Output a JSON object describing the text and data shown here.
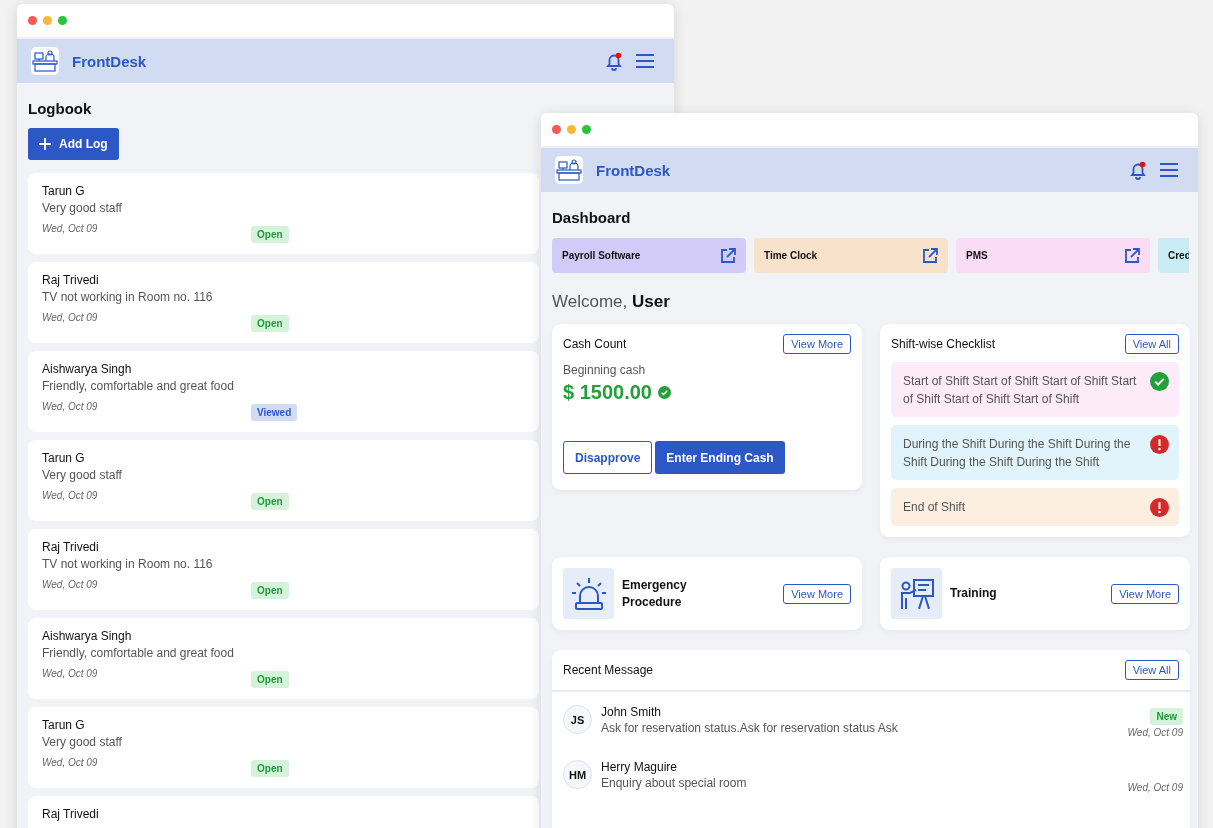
{
  "logbook_window": {
    "app_name": "FrontDesk",
    "notification": true,
    "page_title": "Logbook",
    "add_button": "Add Log",
    "logs": [
      {
        "name": "Tarun G",
        "text": "Very good staff",
        "date": "Wed, Oct 09",
        "status": "Open",
        "kind": "open"
      },
      {
        "name": "Raj Trivedi",
        "text": "TV not working in Room no. 116",
        "date": "Wed, Oct 09",
        "status": "Open",
        "kind": "open"
      },
      {
        "name": "Aishwarya Singh",
        "text": "Friendly, comfortable and great food",
        "date": "Wed, Oct 09",
        "status": "Viewed",
        "kind": "viewed"
      },
      {
        "name": "Tarun G",
        "text": "Very good staff",
        "date": "Wed, Oct 09",
        "status": "Open",
        "kind": "open"
      },
      {
        "name": "Raj Trivedi",
        "text": "TV not working in Room no. 116",
        "date": "Wed, Oct 09",
        "status": "Open",
        "kind": "open"
      },
      {
        "name": "Aishwarya Singh",
        "text": "Friendly, comfortable and great food",
        "date": "Wed, Oct 09",
        "status": "Open",
        "kind": "open"
      },
      {
        "name": "Tarun G",
        "text": "Very good staff",
        "date": "Wed, Oct 09",
        "status": "Open",
        "kind": "open"
      },
      {
        "name": "Raj Trivedi"
      }
    ]
  },
  "dashboard_window": {
    "app_name": "FrontDesk",
    "notification": true,
    "page_title": "Dashboard",
    "shortcuts": [
      {
        "label": "Payroll Software",
        "color": "#d2cbf8"
      },
      {
        "label": "Time Clock",
        "color": "#f8e2cc"
      },
      {
        "label": "PMS",
        "color": "#fbdcf6"
      },
      {
        "label": "Cred",
        "color": "#c9ecf5"
      }
    ],
    "welcome": "Welcome, **User**",
    "cash_count": {
      "title": "Cash Count",
      "link": "View More",
      "label": "Beginning cash",
      "amount": "$ 1500.00",
      "verified": true,
      "buttons": [
        "Disapprove",
        "Enter Ending Cash"
      ]
    },
    "checklist": {
      "title": "Shift-wise Checklist",
      "link": "View All",
      "items": [
        {
          "text": "Start of Shift Start of Shift Start of Shift Start of Shift Start of Shift Start of Shift",
          "done": true,
          "color": "#fdebfa"
        },
        {
          "text": "During the Shift During the Shift During the Shift During the Shift During the Shift",
          "done": false,
          "color": "#e2f4fb"
        },
        {
          "text": "End of Shift",
          "done": false,
          "color": "#fcefe2"
        }
      ]
    },
    "procedures": [
      {
        "title": "Emergency Procedure",
        "link": "View More",
        "kind": "siren"
      },
      {
        "title": "Training",
        "link": "View More",
        "kind": "training"
      }
    ],
    "messages": {
      "title": "Recent Message",
      "link": "View All",
      "items": [
        {
          "initials": "JS",
          "name": "John Smith",
          "text": "Ask for reservation status.Ask for reservation status Ask",
          "badge": "New",
          "date": "Wed, Oct 09"
        },
        {
          "initials": "HM",
          "name": "Herry Maguire",
          "text": "Enquiry about special room",
          "date": "Wed, Oct 09"
        }
      ]
    }
  }
}
